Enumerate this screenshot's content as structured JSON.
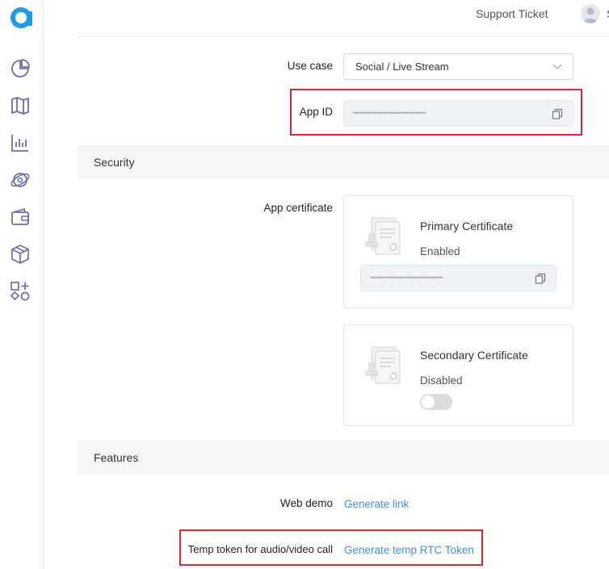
{
  "header": {
    "support_label": "Support Ticket",
    "user_initial": "S"
  },
  "sidebar": {
    "items": [
      {
        "icon": "pie-chart-icon"
      },
      {
        "icon": "map-icon"
      },
      {
        "icon": "bar-chart-icon"
      },
      {
        "icon": "globe-icon"
      },
      {
        "icon": "wallet-icon"
      },
      {
        "icon": "cube-icon"
      },
      {
        "icon": "shapes-icon"
      }
    ]
  },
  "project": {
    "use_case_label": "Use case",
    "use_case_value": "Social / Live Stream",
    "app_id_label": "App ID",
    "app_id_masked": "••••••••••••••••••••••••••••••••••"
  },
  "security": {
    "title": "Security",
    "cert_label": "App certificate",
    "primary": {
      "title": "Primary Certificate",
      "status": "Enabled",
      "masked": "••••••••••••••••••••••••••••••••••"
    },
    "secondary": {
      "title": "Secondary Certificate",
      "status": "Disabled",
      "enabled": false
    }
  },
  "features": {
    "title": "Features",
    "web_demo_label": "Web demo",
    "web_demo_link": "Generate link",
    "temp_token_label": "Temp token for audio/video call",
    "temp_token_link": "Generate temp RTC Token"
  },
  "colors": {
    "brand": "#1d9bf0",
    "link": "#3f8fe0",
    "highlight": "#e0252e",
    "icon": "#6b6fa8"
  }
}
